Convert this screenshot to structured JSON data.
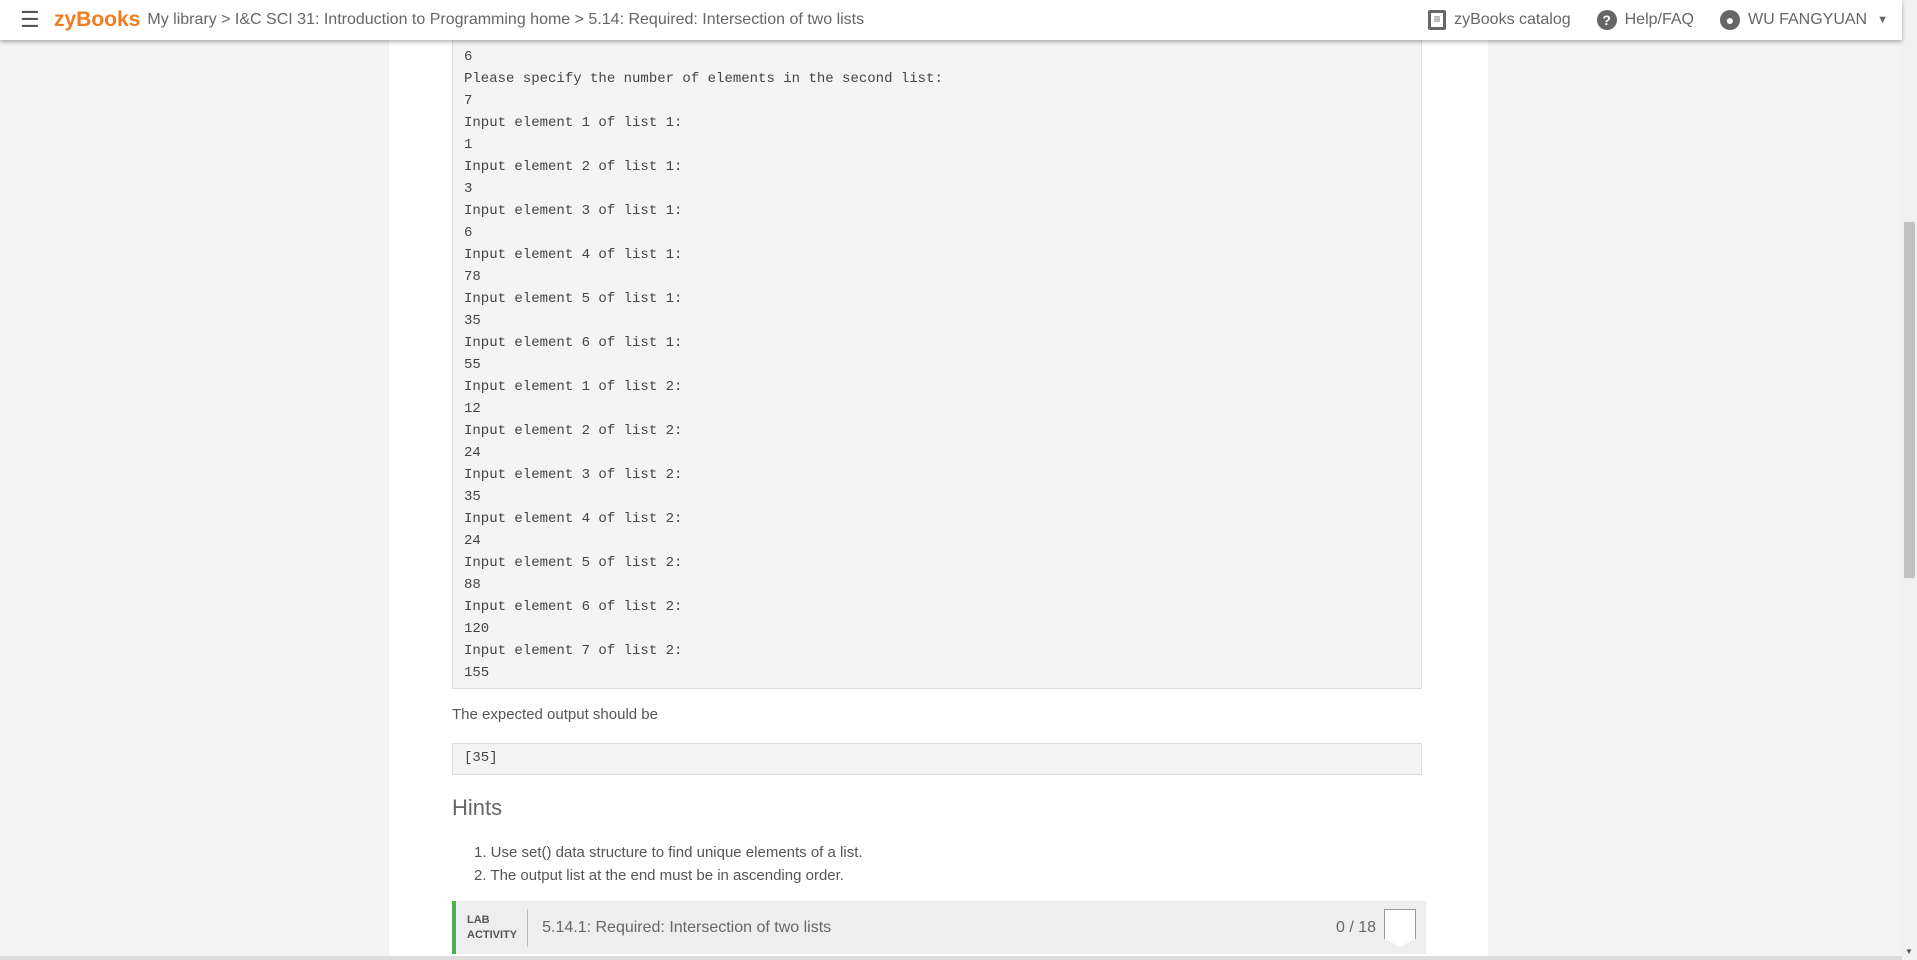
{
  "header": {
    "logo": "zyBooks",
    "breadcrumb": "My library > I&C SCI 31: Introduction to Programming home > 5.14: Required: Intersection of two lists",
    "catalog": "zyBooks catalog",
    "help": "Help/FAQ",
    "user": "WU FANGYUAN"
  },
  "code_lines": [
    "6",
    "Please specify the number of elements in the second list:",
    "7",
    "Input element 1 of list 1:",
    "1",
    "Input element 2 of list 1:",
    "3",
    "Input element 3 of list 1:",
    "6",
    "Input element 4 of list 1:",
    "78",
    "Input element 5 of list 1:",
    "35",
    "Input element 6 of list 1:",
    "55",
    "Input element 1 of list 2:",
    "12",
    "Input element 2 of list 2:",
    "24",
    "Input element 3 of list 2:",
    "35",
    "Input element 4 of list 2:",
    "24",
    "Input element 5 of list 2:",
    "88",
    "Input element 6 of list 2:",
    "120",
    "Input element 7 of list 2:",
    "155"
  ],
  "expected_label": "The expected output should be",
  "expected_output": "[35]",
  "hints": {
    "title": "Hints",
    "items": [
      "1. Use set() data structure to find unique elements of a list.",
      "2. The output list at the end must be in ascending order."
    ]
  },
  "lab": {
    "tag1": "LAB",
    "tag2": "ACTIVITY",
    "title": "5.14.1: Required: Intersection of two lists",
    "score": "0 / 18"
  },
  "colors": {
    "brand": "#f47c20",
    "lab_accent": "#4caf50"
  }
}
